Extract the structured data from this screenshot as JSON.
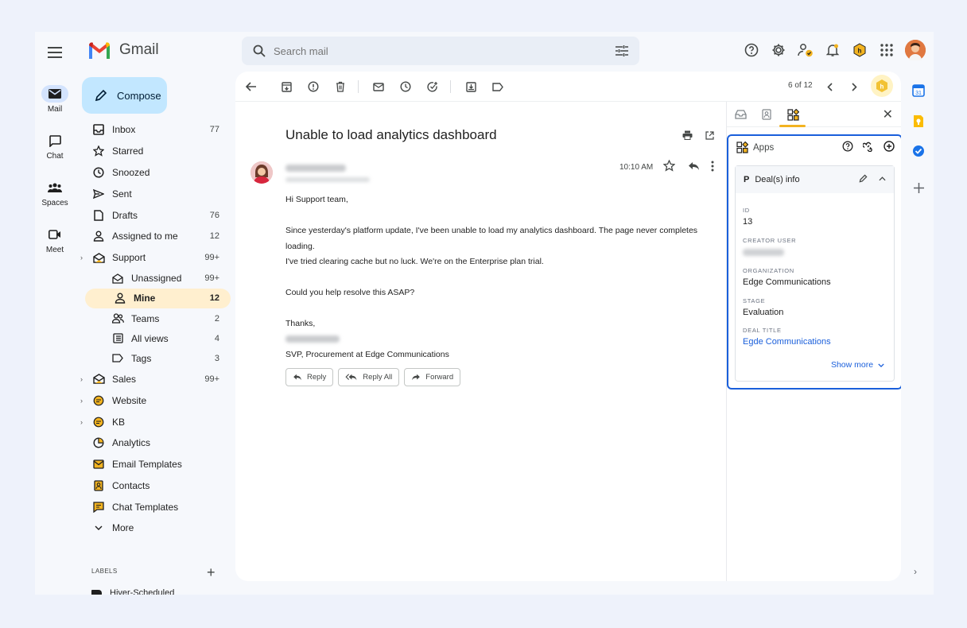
{
  "app": {
    "name": "Gmail"
  },
  "rail": {
    "items": [
      {
        "label": "Mail",
        "icon": "mail-icon",
        "active": true
      },
      {
        "label": "Chat",
        "icon": "chat-icon"
      },
      {
        "label": "Spaces",
        "icon": "spaces-icon"
      },
      {
        "label": "Meet",
        "icon": "meet-icon"
      }
    ]
  },
  "search": {
    "placeholder": "Search mail"
  },
  "compose": {
    "label": "Compose"
  },
  "nav": {
    "items": [
      {
        "label": "Inbox",
        "count": "77",
        "icon": "inbox-icon"
      },
      {
        "label": "Starred",
        "count": "",
        "icon": "star-icon"
      },
      {
        "label": "Snoozed",
        "count": "",
        "icon": "clock-icon"
      },
      {
        "label": "Sent",
        "count": "",
        "icon": "send-icon"
      },
      {
        "label": "Drafts",
        "count": "76",
        "icon": "draft-icon"
      },
      {
        "label": "Assigned to me",
        "count": "12",
        "icon": "person-check-icon"
      },
      {
        "label": "Support",
        "count": "99+",
        "icon": "shared-inbox-icon"
      }
    ],
    "sub": [
      {
        "label": "Unassigned",
        "count": "99+",
        "icon": "envelope-open-icon"
      },
      {
        "label": "Mine",
        "count": "12",
        "icon": "person-icon",
        "active": true
      },
      {
        "label": "Teams",
        "count": "2",
        "icon": "team-icon"
      },
      {
        "label": "All views",
        "count": "4",
        "icon": "views-icon"
      },
      {
        "label": "Tags",
        "count": "3",
        "icon": "tag-icon"
      }
    ],
    "rest": [
      {
        "label": "Sales",
        "count": "99+",
        "icon": "shared-inbox-icon",
        "caret": true
      },
      {
        "label": "Website",
        "count": "",
        "icon": "chat-bubble-icon",
        "caret": true
      },
      {
        "label": "KB",
        "count": "",
        "icon": "chat-bubble-icon",
        "caret": true
      },
      {
        "label": "Analytics",
        "count": "",
        "icon": "pie-chart-icon"
      },
      {
        "label": "Email Templates",
        "count": "",
        "icon": "template-icon"
      },
      {
        "label": "Contacts",
        "count": "",
        "icon": "contacts-icon"
      },
      {
        "label": "Chat Templates",
        "count": "",
        "icon": "chat-template-icon"
      },
      {
        "label": "More",
        "count": "",
        "icon": "chevron-down-icon"
      }
    ],
    "labels_header": "LABELS",
    "label_cut": "Hiver-Scheduled"
  },
  "toolbar": {
    "pager": "6 of 12"
  },
  "email": {
    "subject": "Unable to load analytics dashboard",
    "time": "10:10 AM",
    "greeting": "Hi Support team,",
    "line1": "Since yesterday's platform update, I've been unable to load my analytics dashboard. The page never completes loading.",
    "line2": "I've tried clearing cache but no luck. We're on the Enterprise plan trial.",
    "line3": "Could you help resolve this ASAP?",
    "thanks": "Thanks,",
    "signature_title": "SVP, Procurement at Edge Communications",
    "reply": "Reply",
    "reply_all": "Reply All",
    "forward": "Forward"
  },
  "side_panel": {
    "apps_title": "Apps",
    "card_title": "Deal(s) info",
    "fields": [
      {
        "label": "ID",
        "value": "13"
      },
      {
        "label": "CREATOR USER",
        "value": ""
      },
      {
        "label": "ORGANIZATION",
        "value": "Edge Communications"
      },
      {
        "label": "STAGE",
        "value": "Evaluation"
      },
      {
        "label": "DEAL TITLE",
        "value": "Egde Communications"
      }
    ],
    "show_more": "Show more"
  },
  "colors": {
    "accent_blue": "#1a5fdb",
    "compose_bg": "#c2e7ff",
    "active_nav": "#ffefcf",
    "hiver_yellow": "#f2b320"
  }
}
